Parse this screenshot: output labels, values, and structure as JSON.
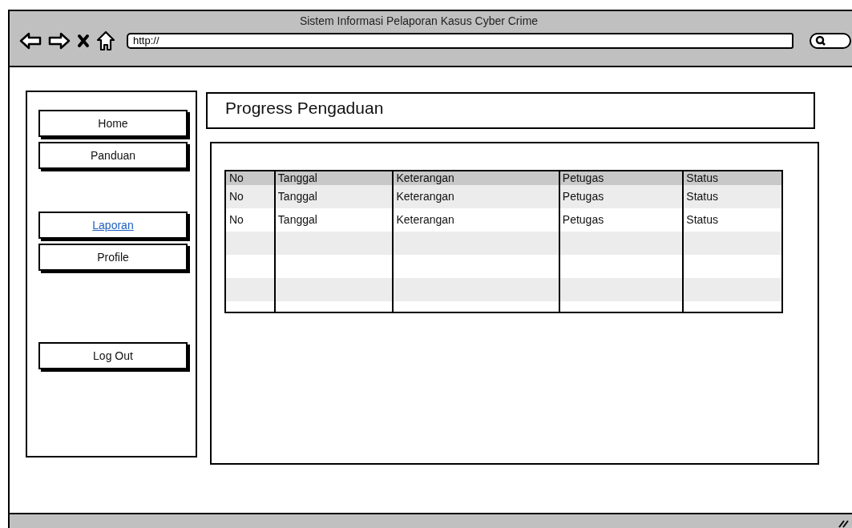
{
  "window": {
    "title": "Sistem Informasi Pelaporan Kasus Cyber Crime"
  },
  "address_bar": {
    "value": "http://"
  },
  "sidebar": {
    "items": [
      {
        "label": "Home",
        "kind": "button"
      },
      {
        "label": "Panduan",
        "kind": "button"
      },
      {
        "label": "Laporan",
        "kind": "link"
      },
      {
        "label": "Profile",
        "kind": "button"
      },
      {
        "label": "Log Out",
        "kind": "button"
      }
    ]
  },
  "page": {
    "title": "Progress Pengaduan"
  },
  "table": {
    "columns": [
      "No",
      "Tanggal",
      "Keterangan",
      "Petugas",
      "Status"
    ],
    "rows": [
      [
        "No",
        "Tanggal",
        "Keterangan",
        "Petugas",
        "Status"
      ],
      [
        "No",
        "Tanggal",
        "Keterangan",
        "Petugas",
        "Status"
      ]
    ]
  }
}
